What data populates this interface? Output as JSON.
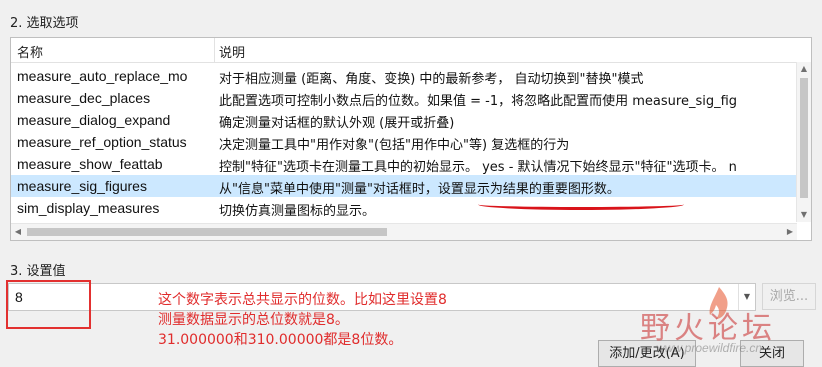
{
  "sections": {
    "select_option_title": "2. 选取选项",
    "set_value_title": "3. 设置值"
  },
  "list": {
    "columns": {
      "name": "名称",
      "description": "说明"
    },
    "rows": [
      {
        "name": "measure_auto_replace_mo",
        "desc": "对于相应测量 (距离、角度、变换) 中的最新参考， 自动切换到\"替换\"模式"
      },
      {
        "name": "measure_dec_places",
        "desc": "此配置选项可控制小数点后的位数。如果值 = -1，将忽略此配置而使用 measure_sig_fig"
      },
      {
        "name": "measure_dialog_expand",
        "desc": "确定测量对话框的默认外观 (展开或折叠)"
      },
      {
        "name": "measure_ref_option_status",
        "desc": "决定测量工具中\"用作对象\"(包括\"用作中心\"等) 复选框的行为"
      },
      {
        "name": "measure_show_feattab",
        "desc": "控制\"特征\"选项卡在测量工具中的初始显示。 yes - 默认情况下始终显示\"特征\"选项卡。 n"
      },
      {
        "name": "measure_sig_figures",
        "desc": "从\"信息\"菜单中使用\"测量\"对话框时，设置显示为结果的重要图形数。"
      },
      {
        "name": "sim_display_measures",
        "desc": "切换仿真测量图标的显示。"
      },
      {
        "name": "",
        "desc": ""
      }
    ],
    "selected_index": 5
  },
  "value_field": {
    "value": "8"
  },
  "buttons": {
    "browse": "浏览...",
    "add_change": "添加/更改(A)",
    "close": "关闭"
  },
  "annotation": {
    "line1": "这个数字表示总共显示的位数。比如这里设置8",
    "line2": "测量数据显示的总位数就是8。",
    "line3": "31.000000和310.00000都是8位数。"
  },
  "watermark": {
    "title": "野火论坛",
    "url": "www.proewildfire.cn"
  },
  "colors": {
    "selected_row": "#cce8ff",
    "annotation_red": "#e02c2c",
    "highlight_box": "#e2302f"
  }
}
